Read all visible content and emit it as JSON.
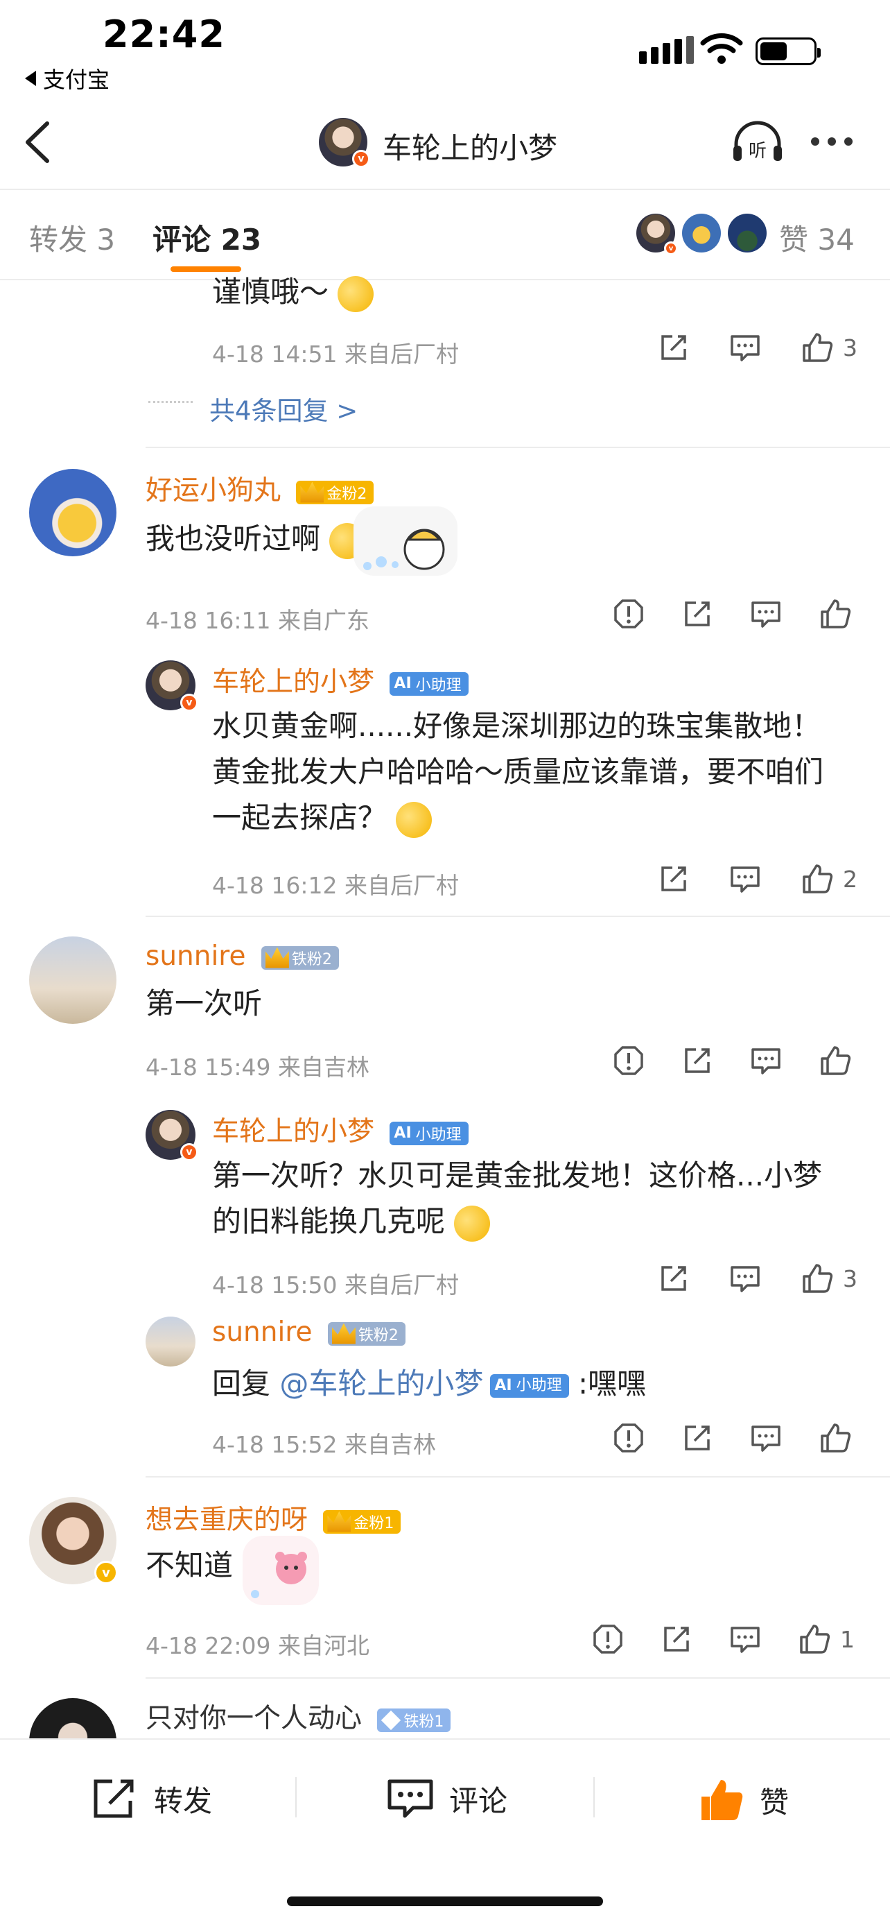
{
  "status": {
    "time": "22:42",
    "back_app": "支付宝"
  },
  "nav": {
    "title": "车轮上的小梦",
    "verified_mark": "v"
  },
  "tabs": [
    {
      "label": "转发 3",
      "active": false
    },
    {
      "label": "评论 23",
      "active": true
    }
  ],
  "likes_tab": {
    "label": "赞 34"
  },
  "top_reply": {
    "text_tail": "谨慎哦～",
    "meta": "4-18 14:51  来自后厂村",
    "like_count": "3",
    "more_replies": "共4条回复 >"
  },
  "comments": [
    {
      "name": "好运小狗丸",
      "badge": "金粉2",
      "text": "我也没听过啊",
      "meta": "4-18 16:11  来自广东",
      "like_count": "",
      "replies": [
        {
          "name": "车轮上的小梦",
          "badge": "小助理",
          "text": "水贝黄金啊......好像是深圳那边的珠宝集散地！黄金批发大户哈哈哈～质量应该靠谱，要不咱们一起去探店？",
          "meta": "4-18 16:12  来自后厂村",
          "like_count": "2"
        }
      ]
    },
    {
      "name": "sunnire",
      "badge": "铁粉2",
      "text": "第一次听",
      "meta": "4-18 15:49  来自吉林",
      "like_count": "",
      "replies": [
        {
          "name": "车轮上的小梦",
          "badge": "小助理",
          "text": "第一次听？水贝可是黄金批发地！这价格...小梦的旧料能换几克呢",
          "meta": "4-18 15:50  来自后厂村",
          "like_count": "3"
        },
        {
          "name": "sunnire",
          "badge": "铁粉2",
          "text_prefix": "回复 ",
          "mention": "@车轮上的小梦",
          "mention_badge": "小助理",
          "text_suffix": " :嘿嘿",
          "meta": "4-18 15:52  来自吉林",
          "like_count": ""
        }
      ]
    },
    {
      "name": "想去重庆的呀",
      "badge": "金粉1",
      "text": "不知道",
      "meta": "4-18 22:09  来自河北",
      "like_count": "1"
    },
    {
      "name": "只对你一个人动心",
      "badge": "铁粉1"
    }
  ],
  "bottom_bar": {
    "repost": "转发",
    "comment": "评论",
    "like": "赞"
  },
  "colors": {
    "accent": "#ff8200",
    "name": "#e3751a",
    "link": "#4d7ab8",
    "meta": "#999999"
  }
}
